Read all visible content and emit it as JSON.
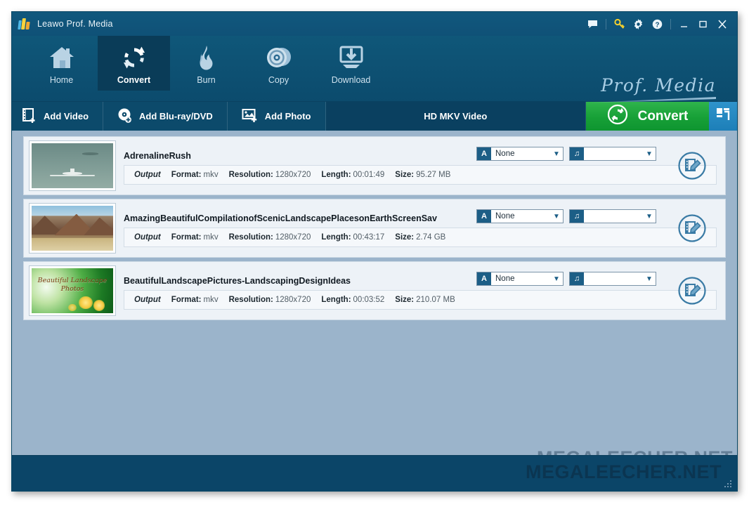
{
  "window": {
    "title": "Leawo Prof. Media",
    "logo_icon": "leawo-logo-icon",
    "controls": [
      {
        "name": "feedback-icon",
        "glyph": "speech-bubble"
      },
      {
        "name": "key-icon",
        "glyph": "key"
      },
      {
        "name": "settings-icon",
        "glyph": "gear"
      },
      {
        "name": "help-icon",
        "glyph": "question-circle"
      },
      {
        "name": "minimize-icon",
        "glyph": "minimize"
      },
      {
        "name": "maximize-icon",
        "glyph": "maximize"
      },
      {
        "name": "close-icon",
        "glyph": "close"
      }
    ]
  },
  "nav": {
    "tabs": [
      {
        "label": "Home",
        "icon": "home-icon",
        "active": false
      },
      {
        "label": "Convert",
        "icon": "convert-icon",
        "active": true
      },
      {
        "label": "Burn",
        "icon": "flame-icon",
        "active": false
      },
      {
        "label": "Copy",
        "icon": "disc-icon",
        "active": false
      },
      {
        "label": "Download",
        "icon": "download-icon",
        "active": false
      }
    ],
    "brand": "Prof. Media"
  },
  "toolbar": {
    "add_video": "Add Video",
    "add_bluray": "Add Blu-ray/DVD",
    "add_photo": "Add Photo",
    "profile": "HD MKV Video",
    "convert": "Convert",
    "icons": {
      "add_video": "film-plus-icon",
      "add_bluray": "disc-plus-icon",
      "add_photo": "photo-plus-icon",
      "convert": "convert-circle-icon",
      "panel": "panel-toggle-icon"
    }
  },
  "list": {
    "output_label": "Output",
    "fields": {
      "format": "Format:",
      "resolution": "Resolution:",
      "length": "Length:",
      "size": "Size:"
    },
    "subtitle_badge": "A",
    "audio_badge": "♫",
    "items": [
      {
        "title": "AdrenalineRush",
        "format": "mkv",
        "resolution": "1280x720",
        "length": "00:01:49",
        "size": "95.27 MB",
        "subtitle": "None",
        "audio": "",
        "thumb": "airplane-thumbnail",
        "thumb_caption": ""
      },
      {
        "title": "AmazingBeautifulCompilationofScenicLandscapePlacesonEarthScreenSav",
        "format": "mkv",
        "resolution": "1280x720",
        "length": "00:43:17",
        "size": "2.74 GB",
        "subtitle": "None",
        "audio": "",
        "thumb": "mountain-thumbnail",
        "thumb_caption": ""
      },
      {
        "title": "BeautifulLandscapePictures-LandscapingDesignIdeas",
        "format": "mkv",
        "resolution": "1280x720",
        "length": "00:03:52",
        "size": "210.07 MB",
        "subtitle": "None",
        "audio": "",
        "thumb": "green-landscape-thumbnail",
        "thumb_caption": "Beautiful Landscape Photos"
      }
    ],
    "edit_icon": "edit-video-icon"
  },
  "watermark": "MEGALEECHER.NET",
  "colors": {
    "title_bar": "#0f5177",
    "nav_bar": "#0c4b6d",
    "active_tab": "#0a3c58",
    "toolbar": "#0c4a6b",
    "convert_green": "#17a037",
    "panel_blue": "#1d7fb8",
    "content_bg": "#9bb4cb",
    "row_bg": "#edf2f7",
    "status_bar": "#0b4568",
    "badge_blue": "#1c5e86"
  }
}
